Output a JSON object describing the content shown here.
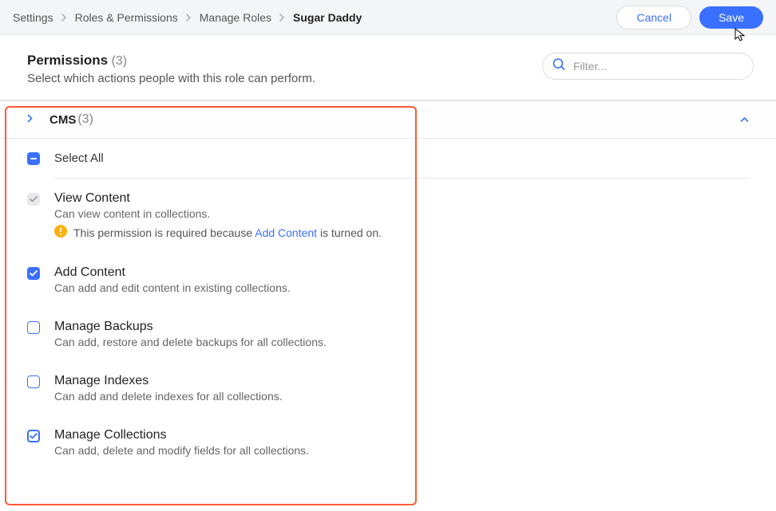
{
  "breadcrumb": {
    "items": [
      {
        "label": "Settings"
      },
      {
        "label": "Roles & Permissions"
      },
      {
        "label": "Manage Roles"
      },
      {
        "label": "Sugar Daddy"
      }
    ]
  },
  "actions": {
    "cancel": "Cancel",
    "save": "Save"
  },
  "title": {
    "heading": "Permissions",
    "count": "(3)",
    "subtitle": "Select which actions people with this role can perform."
  },
  "filter": {
    "placeholder": "Filter..."
  },
  "section": {
    "name": "CMS",
    "count": "(3)",
    "select_all": "Select All"
  },
  "permissions": {
    "view_content": {
      "title": "View Content",
      "desc": "Can view content in collections.",
      "note_prefix": "This permission is required because ",
      "note_link": "Add Content",
      "note_suffix": " is turned on."
    },
    "add_content": {
      "title": "Add Content",
      "desc": "Can add and edit content in existing collections."
    },
    "manage_backups": {
      "title": "Manage Backups",
      "desc": "Can add, restore and delete backups for all collections."
    },
    "manage_indexes": {
      "title": "Manage Indexes",
      "desc": "Can add and delete indexes for all collections."
    },
    "manage_collections": {
      "title": "Manage Collections",
      "desc": "Can add, delete and modify fields for all collections."
    }
  }
}
